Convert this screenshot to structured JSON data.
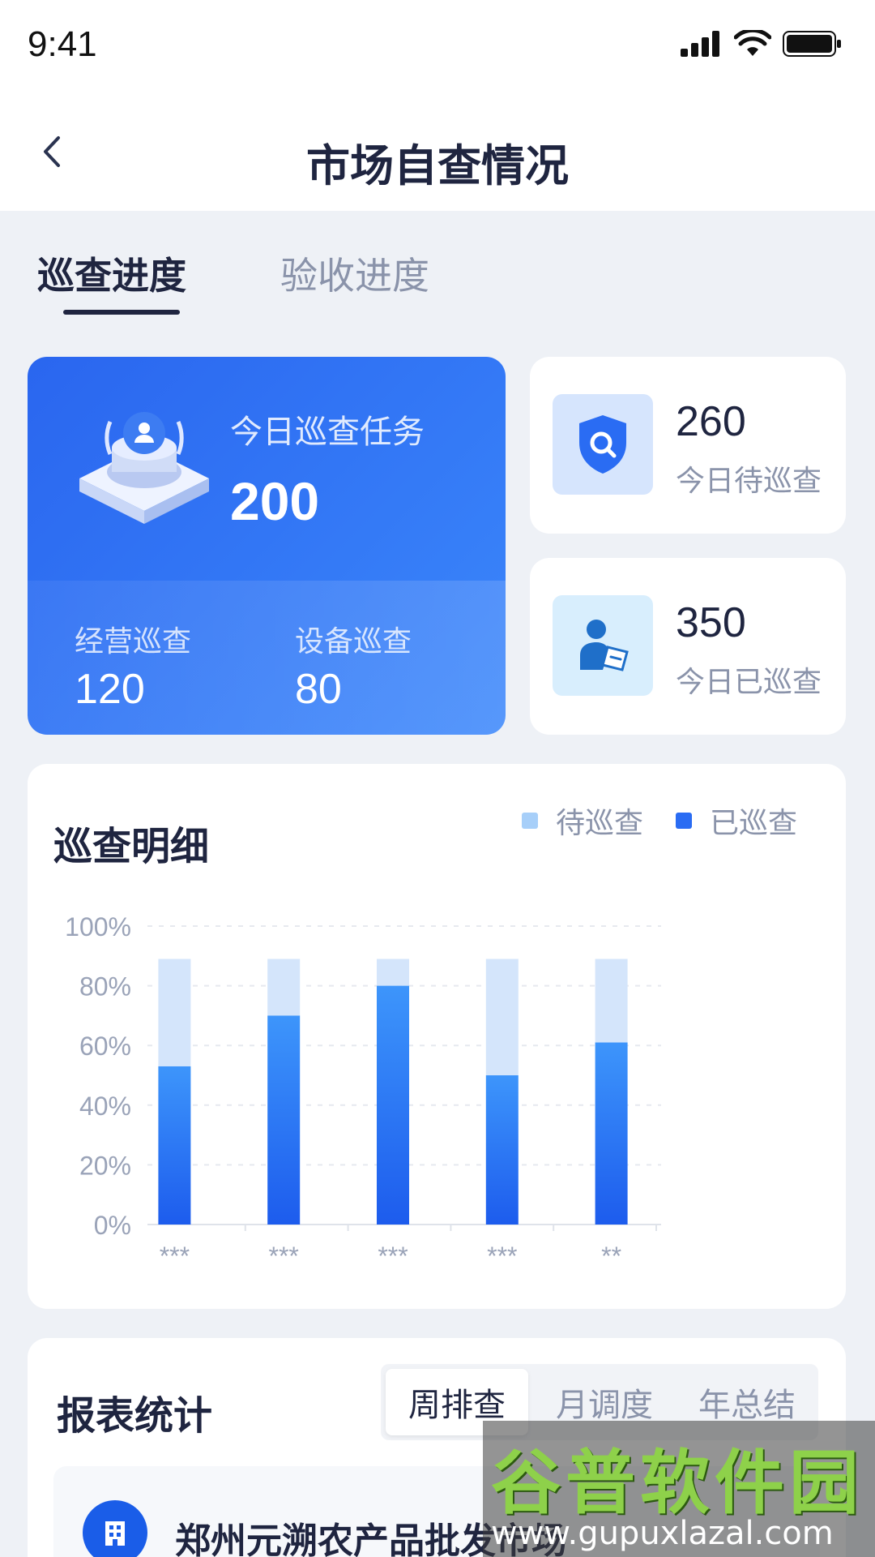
{
  "status_bar": {
    "time": "9:41"
  },
  "header": {
    "title": "市场自查情况"
  },
  "tabs": [
    {
      "label": "巡查进度",
      "active": true
    },
    {
      "label": "验收进度",
      "active": false
    }
  ],
  "today_task": {
    "label": "今日巡查任务",
    "value": "200",
    "business_label": "经营巡查",
    "business_value": "120",
    "equipment_label": "设备巡查",
    "equipment_value": "80"
  },
  "pending": {
    "value": "260",
    "label": "今日待巡查",
    "icon": "shield-search-icon"
  },
  "done": {
    "value": "350",
    "label": "今日已巡查",
    "icon": "inspector-icon"
  },
  "detail": {
    "title": "巡查明细",
    "legend_pending": "待巡查",
    "legend_done": "已巡查"
  },
  "chart_data": {
    "type": "bar",
    "stacked": true,
    "categories": [
      "***",
      "***",
      "***",
      "***",
      "**"
    ],
    "series": [
      {
        "name": "已巡查",
        "values": [
          53,
          70,
          80,
          50,
          61
        ],
        "color": "#2a6cf3"
      },
      {
        "name": "待巡查",
        "values": [
          36,
          19,
          9,
          39,
          28
        ],
        "color": "#d4e5fb"
      }
    ],
    "yticks": [
      "0%",
      "20%",
      "40%",
      "60%",
      "80%",
      "100%"
    ],
    "ylim": [
      0,
      100
    ],
    "grid": true,
    "legend_position": "top-right"
  },
  "report": {
    "title": "报表统计",
    "options": [
      {
        "label": "周排查",
        "selected": true
      },
      {
        "label": "月调度",
        "selected": false
      },
      {
        "label": "年总结",
        "selected": false
      }
    ],
    "market_name": "郑州元溯农产品批发市场"
  },
  "watermark": {
    "text": "谷普软件园",
    "url": "www.gupuxlazal.com"
  },
  "colors": {
    "accent": "#2a66ef",
    "accent_light": "#3b87fb",
    "bg": "#eef1f6"
  }
}
